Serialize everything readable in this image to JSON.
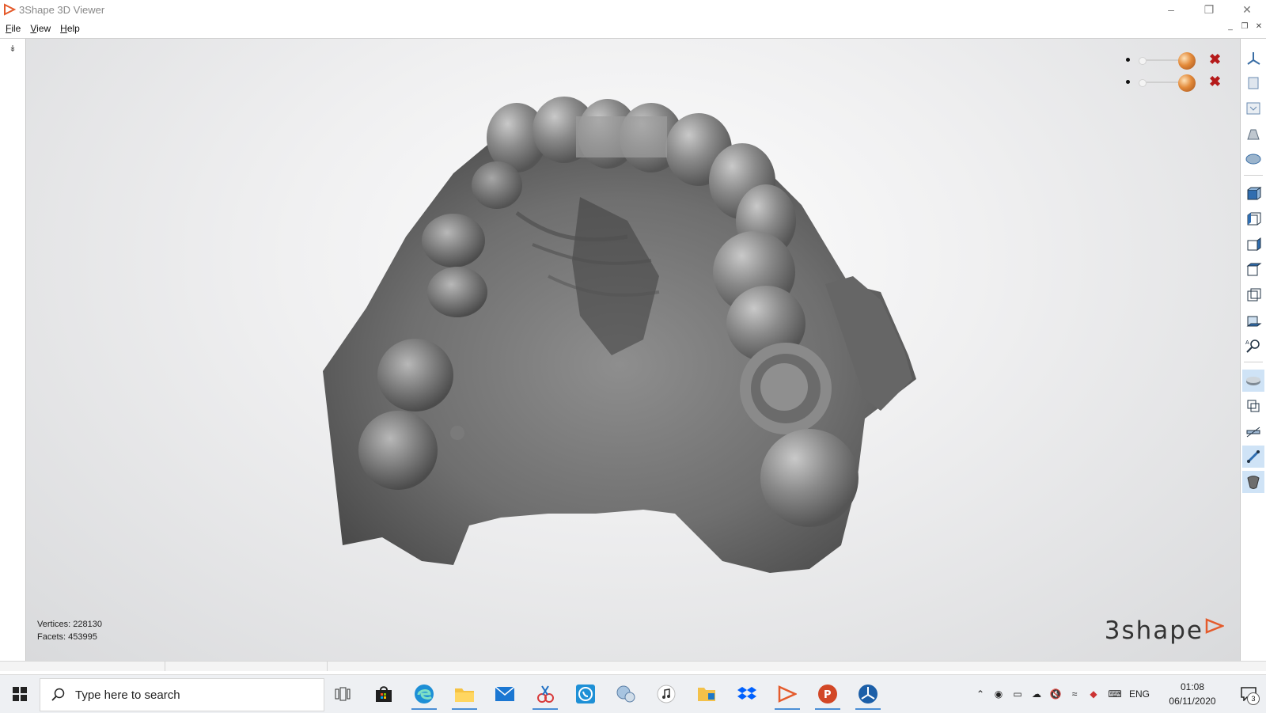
{
  "window": {
    "title": "3Shape 3D Viewer"
  },
  "menu": {
    "file": "File",
    "view": "View",
    "help": "Help"
  },
  "viewport": {
    "stats": {
      "vertices": "Vertices: 228130",
      "facets": "Facets: 453995"
    },
    "brand": "3shape",
    "sliders": [
      {
        "value": 0.0
      },
      {
        "value": 0.0
      }
    ]
  },
  "right_toolbar": {
    "buttons": [
      "axes-icon",
      "view-front-icon",
      "view-top-icon",
      "view-side-icon",
      "view-bottom-icon",
      "cube-front-icon",
      "cube-left-icon",
      "cube-right-icon",
      "cube-back-icon",
      "cube-top-icon",
      "cube-bottom-icon",
      "zoom-icon",
      "clip-icon",
      "transparency-icon",
      "measure-icon",
      "section-icon",
      "shading-icon"
    ]
  },
  "taskbar": {
    "search_placeholder": "Type here to search",
    "language": "ENG",
    "time": "01:08",
    "date": "06/11/2020",
    "notification_count": "3"
  },
  "colors": {
    "accent": "#4a8fd6",
    "close_red": "#b51a1a",
    "brand_orange": "#e45b2c"
  }
}
